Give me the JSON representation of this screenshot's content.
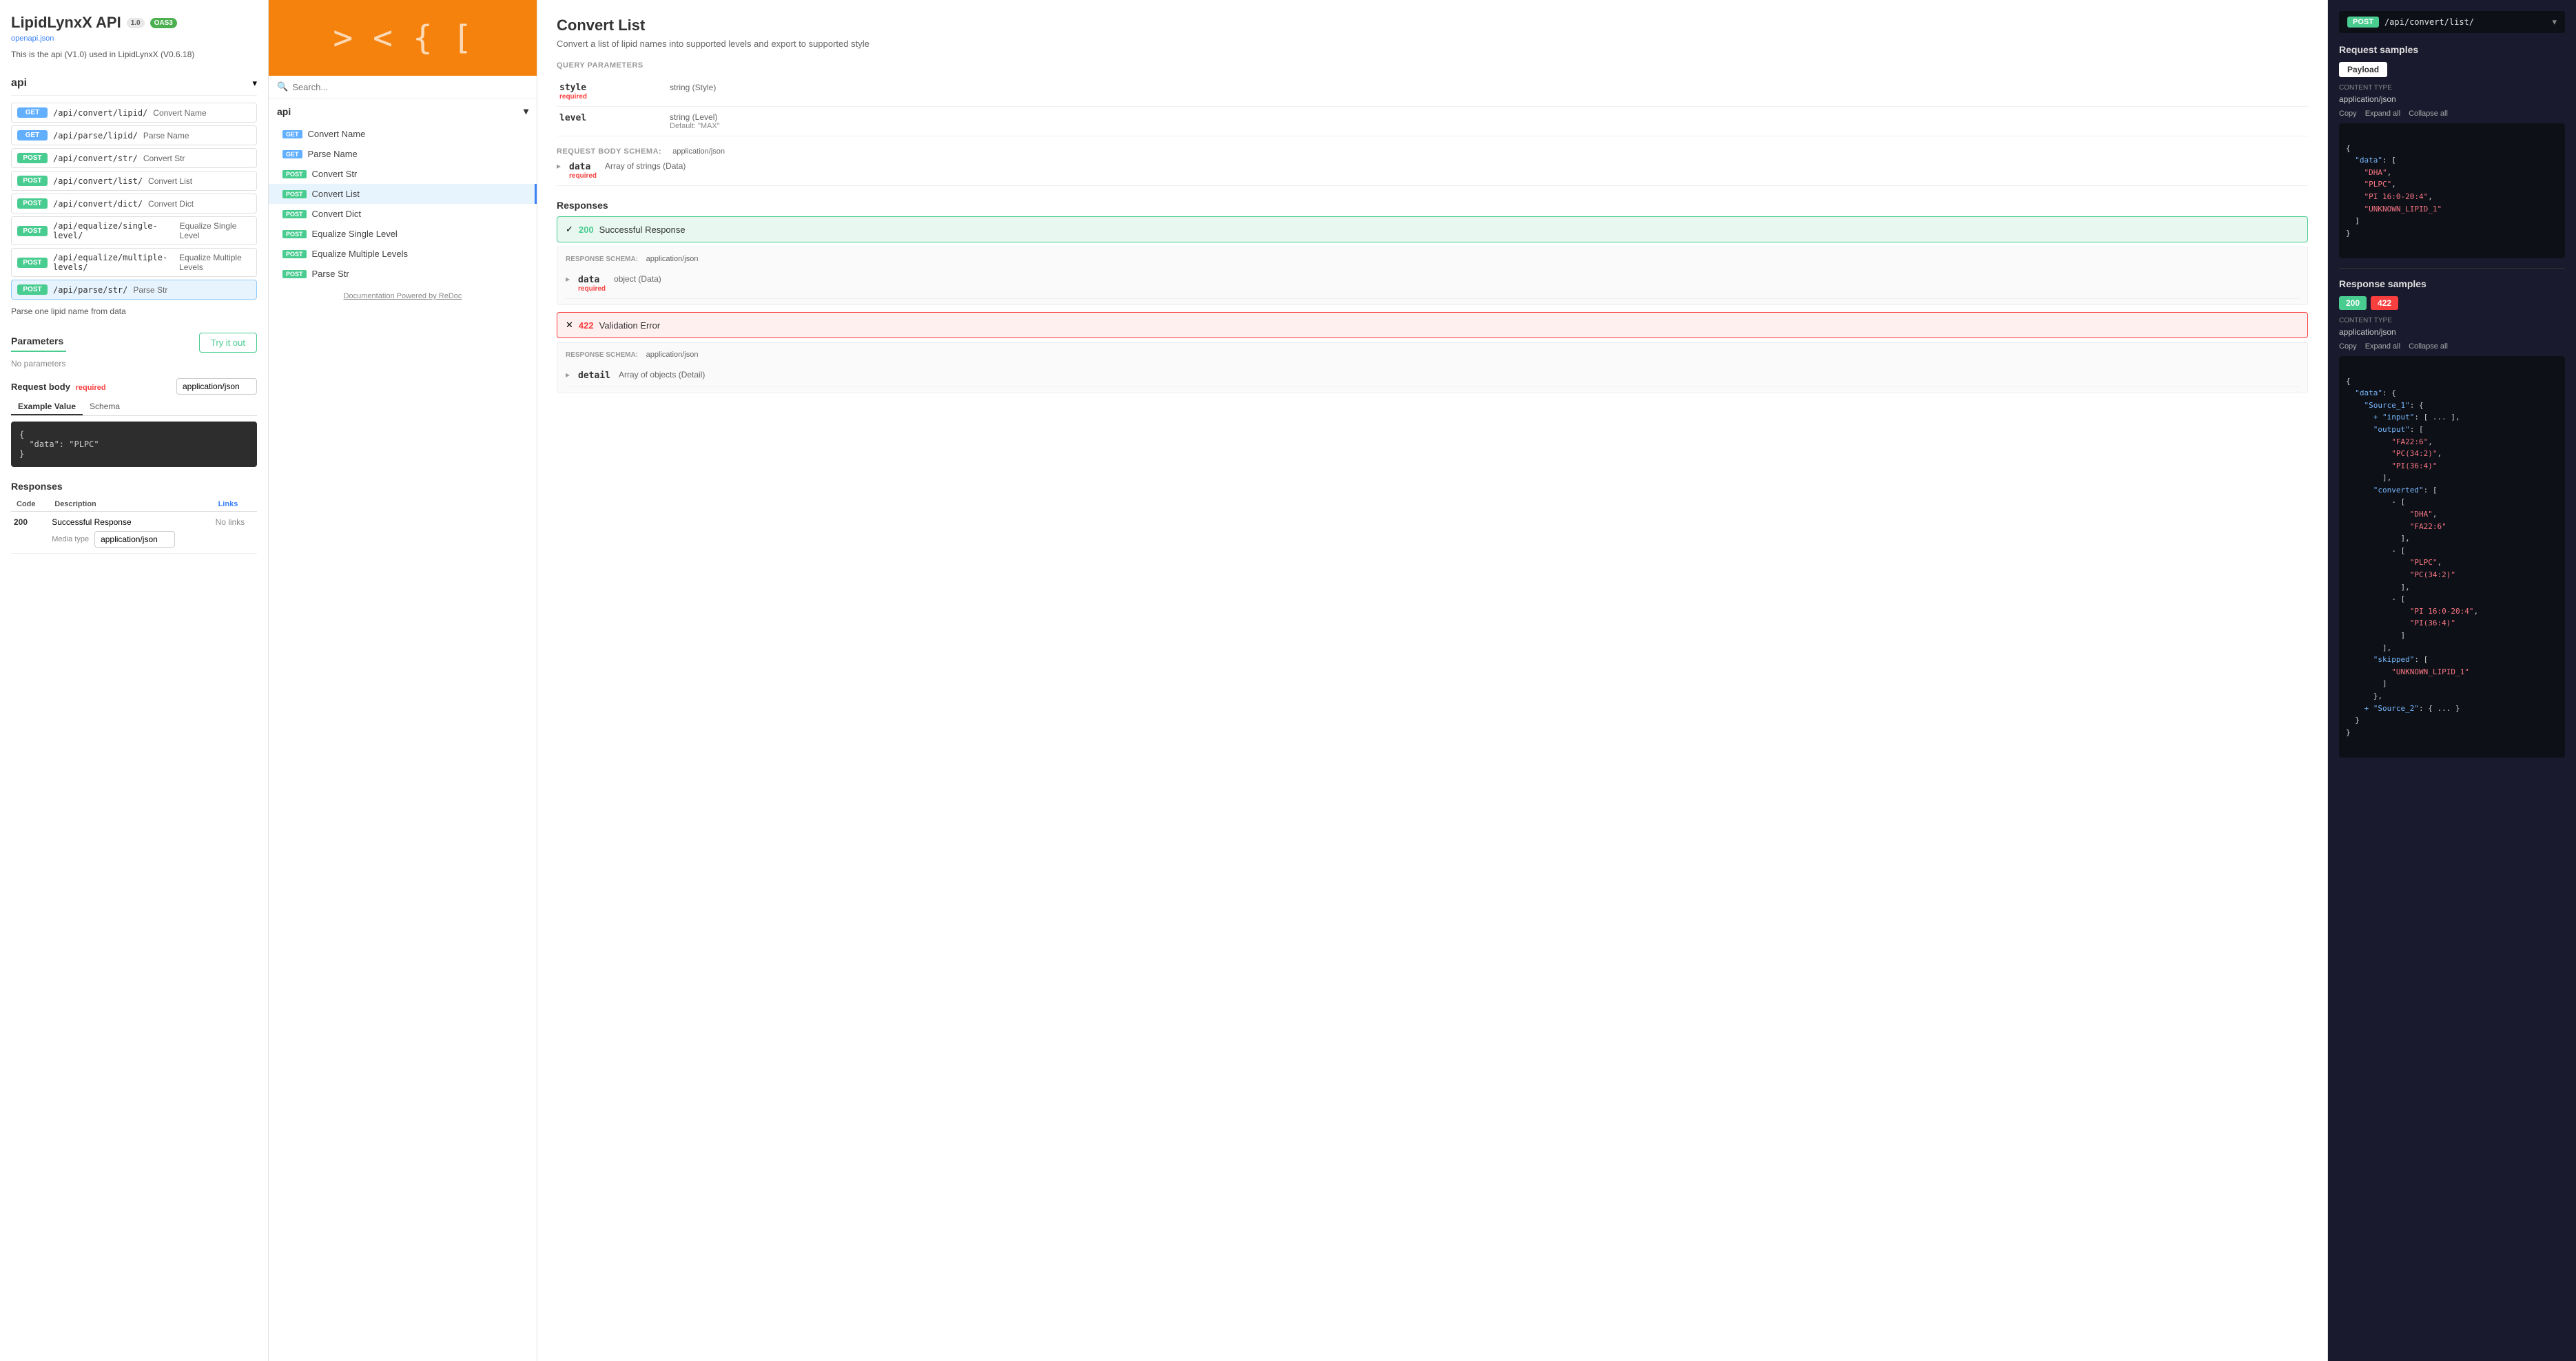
{
  "app": {
    "title": "LipidLynxX API",
    "version_badge": "1.0",
    "oas_badge": "OAS3",
    "openapi_link": "openapi.json",
    "description": "This is the api (V1.0) used in LipidLynxX (V0.6.18)"
  },
  "left": {
    "section": "api",
    "endpoints": [
      {
        "method": "GET",
        "path": "/api/convert/lipid/",
        "desc": "Convert Name"
      },
      {
        "method": "GET",
        "path": "/api/parse/lipid/",
        "desc": "Parse Name"
      },
      {
        "method": "POST",
        "path": "/api/convert/str/",
        "desc": "Convert Str"
      },
      {
        "method": "POST",
        "path": "/api/convert/list/",
        "desc": "Convert List"
      },
      {
        "method": "POST",
        "path": "/api/convert/dict/",
        "desc": "Convert Dict"
      },
      {
        "method": "POST",
        "path": "/api/equalize/single-level/",
        "desc": "Equalize Single Level"
      },
      {
        "method": "POST",
        "path": "/api/equalize/multiple-levels/",
        "desc": "Equalize Multiple Levels"
      },
      {
        "method": "POST",
        "path": "/api/parse/str/",
        "desc": "Parse Str"
      }
    ],
    "active_endpoint_index": 7,
    "active_desc": "Parse one lipid name from data",
    "parameters_title": "Parameters",
    "no_params": "No parameters",
    "request_body_label": "Request body",
    "required_label": "required",
    "content_type_option": "application/json",
    "example_value_tab": "Example Value",
    "schema_tab": "Schema",
    "code_example": "{\n  \"data\": \"PLPC\"\n}",
    "try_it_btn": "Try it out",
    "responses_title": "Responses",
    "resp_table": {
      "headers": [
        "Code",
        "Description",
        "Links"
      ],
      "rows": [
        {
          "code": "200",
          "desc": "Successful Response",
          "links": "No links"
        }
      ]
    },
    "media_type_label": "Media type",
    "media_type_value": "application/json"
  },
  "center": {
    "search_placeholder": "Search...",
    "api_section": "api",
    "nav_items": [
      {
        "method": "GET",
        "label": "Convert Name"
      },
      {
        "method": "GET",
        "label": "Parse Name"
      },
      {
        "method": "POST",
        "label": "Convert Str"
      },
      {
        "method": "POST",
        "label": "Convert List",
        "active": true
      },
      {
        "method": "POST",
        "label": "Convert Dict"
      },
      {
        "method": "POST",
        "label": "Equalize Single Level"
      },
      {
        "method": "POST",
        "label": "Equalize Multiple Levels"
      },
      {
        "method": "POST",
        "label": "Parse Str"
      }
    ],
    "redoc_link": "Documentation Powered by ReDoc"
  },
  "main": {
    "title": "Convert List",
    "subtitle": "Convert a list of lipid names into supported levels and export to supported style",
    "query_params_label": "QUERY PARAMETERS",
    "params": [
      {
        "name": "style",
        "required": true,
        "type": "string (Style)"
      },
      {
        "name": "level",
        "required": false,
        "type": "string (Level)",
        "default": "Default: \"MAX\""
      }
    ],
    "request_body_schema_label": "REQUEST BODY SCHEMA:",
    "request_body_schema_type": "application/json",
    "body_fields": [
      {
        "name": "data",
        "required": true,
        "type": "Array of strings (Data)"
      }
    ],
    "responses_title": "Responses",
    "responses": [
      {
        "code": "200",
        "desc": "Successful Response",
        "type": "success",
        "schema_label": "RESPONSE SCHEMA:",
        "schema_type": "application/json",
        "fields": [
          {
            "name": "data",
            "required": true,
            "type": "object (Data)",
            "expandable": true
          }
        ]
      },
      {
        "code": "422",
        "desc": "Validation Error",
        "type": "error",
        "schema_label": "RESPONSE SCHEMA:",
        "schema_type": "application/json",
        "fields": [
          {
            "name": "detail",
            "required": false,
            "type": "Array of objects (Detail)",
            "expandable": true
          }
        ]
      }
    ]
  },
  "right": {
    "endpoint_method": "POST",
    "endpoint_url": "/api/convert/list/",
    "request_samples_title": "Request samples",
    "payload_btn": "Payload",
    "content_type_label": "Content type",
    "content_type_value": "application/json",
    "copy_btn": "Copy",
    "expand_all_btn": "Expand all",
    "collapse_all_btn": "Collapse all",
    "request_json": "{\n  \"data\": [\n    \"DHA\",\n    \"PLPC\",\n    \"PI 16:0-20:4\",\n    \"UNKNOWN_LIPID_1\"\n  ]\n}",
    "response_samples_title": "Response samples",
    "resp_tab_200": "200",
    "resp_tab_422": "422",
    "resp_content_type_label": "Content type",
    "resp_content_type_value": "application/json",
    "resp_copy_btn": "Copy",
    "resp_expand_all_btn": "Expand all",
    "resp_collapse_all_btn": "Collapse all",
    "response_json": "{\n  \"data\": {\n    \"Source_1\": {\n      \"input\": [ ... ],\n      \"output\": [\n        \"FA22:6\",\n        \"PC(34:2)\",\n        \"PI(36:4)\"\n      ],\n      \"converted\": [\n        [\n          \"DHA\",\n          \"FA22:6\"\n        ],\n        [\n          \"PLPC\",\n          \"PC(34:2)\"\n        ],\n        [\n          \"PI 16:0-20:4\",\n          \"PI(36:4)\"\n        ]\n      ],\n      \"skipped\": [\n        \"UNKNOWN_LIPID_1\"\n      ]\n    },\n    \"Source_2\": { ... }\n  }\n}"
  }
}
